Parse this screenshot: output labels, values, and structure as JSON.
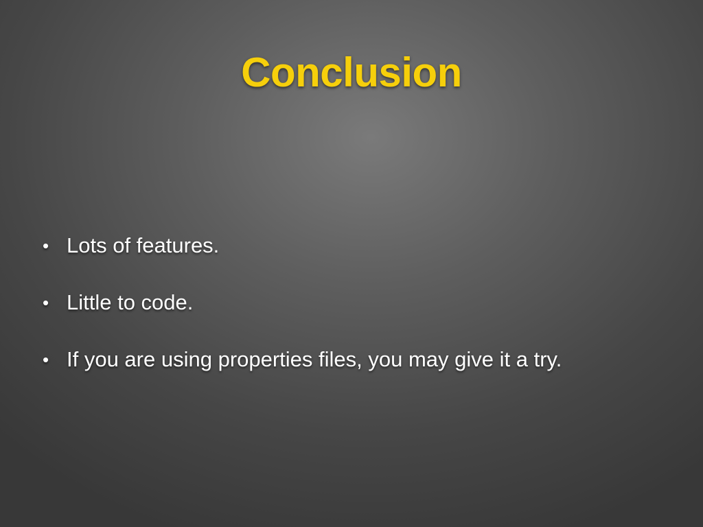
{
  "slide": {
    "title": "Conclusion",
    "bullet_marker": "•",
    "bullets": [
      "Lots of features.",
      "Little to code.",
      "If you are using properties files, you may give it a try."
    ]
  },
  "colors": {
    "title": "#f6cf0b",
    "text": "#ffffff",
    "background": "#5e5e5e"
  }
}
